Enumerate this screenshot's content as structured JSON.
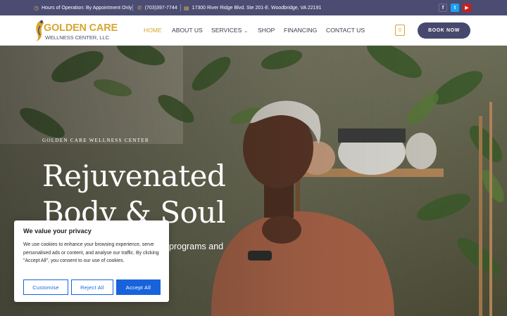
{
  "topbar": {
    "hours": "Hours of Operation: By Appointment Only",
    "phone": "(703)397-7744",
    "address": "17300 River Ridge Blvd. Ste 201-E. Woodbridge, VA 22191",
    "socials": [
      "facebook-icon",
      "twitter-icon",
      "youtube-icon"
    ]
  },
  "logo": {
    "line1": "GOLDEN CARE",
    "line2": "WELLNESS CENTER, LLC"
  },
  "nav": {
    "items": [
      "HOME",
      "ABOUT US",
      "SERVICES",
      "SHOP",
      "FINANCING",
      "CONTACT US"
    ],
    "active": "HOME",
    "cart_count": "0",
    "book_label": "BOOK NOW"
  },
  "hero": {
    "eyebrow": "GOLDEN CARE WELLNESS CENTER",
    "heading_line1": "Rejuvenated",
    "heading_line2": "Body & Soul",
    "subtext": "programs and"
  },
  "cookie": {
    "title": "We value your privacy",
    "body": "We use cookies to enhance your browsing experience, serve personalised ads or content, and analyse our traffic. By clicking \"Accept All\", you consent to our use of cookies.",
    "customise": "Customise",
    "reject": "Reject All",
    "accept": "Accept All"
  },
  "colors": {
    "topbar": "#4a4c72",
    "accent_gold": "#d7a531",
    "book_button": "#46486e",
    "cookie_blue": "#1863dc"
  }
}
